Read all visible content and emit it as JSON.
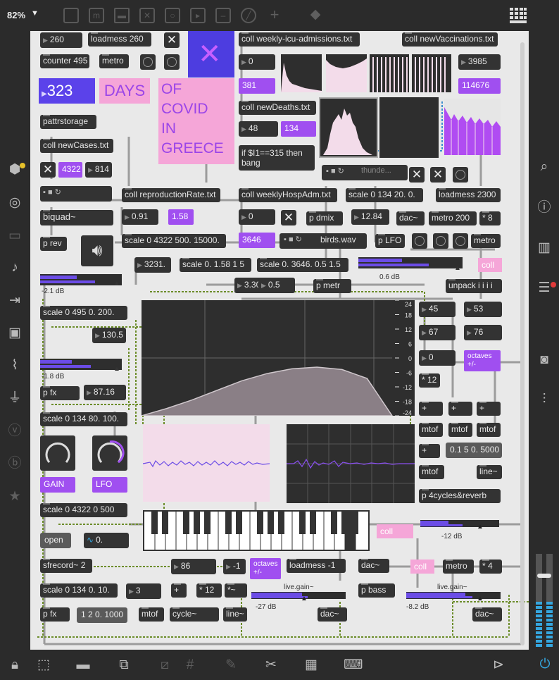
{
  "toolbar": {
    "zoom": "82%",
    "icons": [
      "new-object",
      "new-message",
      "new-comment",
      "new-toggle",
      "new-button",
      "new-number",
      "new-slider",
      "new-dial",
      "add-object",
      "paint-bucket"
    ],
    "grid_icon": "grid-menu-icon"
  },
  "left_sidebar": [
    "package-icon",
    "target-icon",
    "browser-icon",
    "music-icon",
    "snippets-icon",
    "image-icon",
    "clip-icon",
    "plug-icon",
    "vizzie-icon",
    "bpatcher-icon",
    "favorites-icon"
  ],
  "right_sidebar": [
    "search-icon",
    "info-icon",
    "book-icon",
    "list-icon",
    "camera-icon",
    "mixer-icon"
  ],
  "bottom_bar": [
    "lock-icon",
    "presentation-icon",
    "present-mode-icon",
    "patchcord-icon",
    "grid-icon",
    "pin-icon",
    "wrench-icon",
    "piano-icon",
    "keyboard-icon",
    "play-icon",
    "power-icon"
  ],
  "patch": {
    "n260": "260",
    "loadmess260": "loadmess 260",
    "counter": "counter 495",
    "metro": "metro",
    "n323": "323",
    "days": "DAYS",
    "of_covid": [
      "OF",
      "COVID",
      "IN",
      "GREECE"
    ],
    "pattrstorage": "pattrstorage",
    "coll_newcases": "coll newCases.txt",
    "n4322": "4322",
    "n814": "814",
    "coll_repro": "coll reproductionRate.txt",
    "biquad": "biquad~",
    "n091": "0.91",
    "n158": "1.58",
    "scale_4322": "scale 0 4322 500. 15000.",
    "prev": "p rev",
    "n3231": "3231.",
    "scale158": "scale 0. 1.58 1 5",
    "scale3646": "scale 0. 3646. 0.5 1.5",
    "n3304": "3.304",
    "n05": "0.5",
    "pmetr": "p metr",
    "db21": "-2.1 dB",
    "scale495": "scale 0 495 0. 200.",
    "n1305": "130.5",
    "db18": "-1.8 dB",
    "pfx": "p fx",
    "n8716": "87.16",
    "scale134_80": "scale 0 134 80. 100.",
    "gain": "GAIN",
    "lfo": "LFO",
    "scale4322_500": "scale 0 4322 0 500",
    "open": "open",
    "tilde0": "0.",
    "sfrecord": "sfrecord~ 2",
    "scale134_010": "scale 0 134 0. 10.",
    "n3": "3",
    "plus": "+",
    "times12": "* 12",
    "tilde": "*~",
    "pfx2": "p fx",
    "v12000": "1 2 0. 1000",
    "mtof": "mtof",
    "cycle": "cycle~",
    "line": "line~",
    "coll_icu": "coll weekly-icu-admissions.txt",
    "n0": "0",
    "n381": "381",
    "coll_deaths": "coll newDeaths.txt",
    "n48": "48",
    "n134": "134",
    "if_expr": "if $I1==315 then bang",
    "thunder": "thunde...",
    "coll_hosp": "coll weeklyHospAdm.txt",
    "scale134_20": "scale 0 134 20. 0.",
    "loadmess2300": "loadmess 2300",
    "n0b": "0",
    "pdmix": "p dmix",
    "n1284": "12.84",
    "dac": "dac~",
    "metro200": "metro 200",
    "times8": "* 8",
    "n3646": "3646",
    "birds": "birds.wav",
    "plfo": "p LFO",
    "metro2": "metro",
    "coll": "coll",
    "unpack": "unpack i i i i",
    "db06": "0.6 dB",
    "coll_vacc": "coll newVaccinations.txt",
    "n3985": "3985",
    "n114676": "114676",
    "n45": "45",
    "n53": "53",
    "n67": "67",
    "n76": "76",
    "n0c": "0",
    "octaves": "octaves +/-",
    "times12b": "* 12",
    "plus1": "+",
    "plus2": "+",
    "plus3": "+",
    "mtof1": "mtof",
    "mtof2": "mtof",
    "mtof3": "mtof",
    "plus4": "+",
    "v015": "0.1 5 0. 5000",
    "mtof4": "mtof",
    "line2": "line~",
    "p4cycles": "p 4cycles&reverb",
    "coll2": "coll",
    "livegain1": "live.gain~",
    "db12": "-12 dB",
    "n86": "86",
    "nm1": "-1",
    "octaves2": "octaves +/-",
    "loadmess_m1": "loadmess -1",
    "dac2": "dac~",
    "coll3": "coll",
    "metro3": "metro",
    "times4": "* 4",
    "livegain2": "live.gain~",
    "db27": "-27 dB",
    "pbass": "p bass",
    "livegain3": "live.gain~",
    "db82": "-8.2 dB",
    "dac3": "dac~",
    "dac4": "dac~",
    "eq_ticks": [
      "24",
      "18",
      "12",
      "6",
      "0",
      "-6",
      "-12",
      "-18",
      "-24"
    ]
  },
  "chart_data": {
    "type": "area",
    "title": "",
    "xlabel": "",
    "ylabel": "",
    "y_ticks": [
      24,
      18,
      12,
      6,
      0,
      -6,
      -12,
      -18,
      -24
    ],
    "ylim": [
      -24,
      24
    ],
    "x": [
      0,
      0.1,
      0.2,
      0.3,
      0.4,
      0.5,
      0.6,
      0.7,
      0.8,
      0.9,
      1.0
    ],
    "y": [
      -24,
      -21,
      -17.5,
      -13.5,
      -9.5,
      -6.5,
      -4.5,
      -3.8,
      -4.8,
      -8.5,
      -24
    ]
  }
}
